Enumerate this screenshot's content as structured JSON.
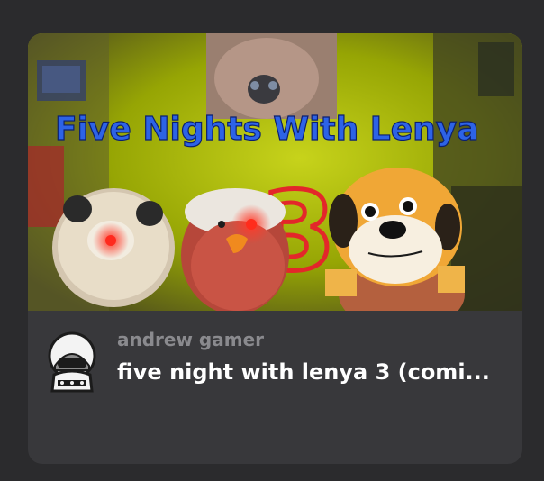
{
  "video": {
    "thumbnail_title": "Five Nights With Lenya",
    "thumbnail_number": "3",
    "channel_name": "andrew gamer",
    "title": "five night with lenya 3 (comi..."
  },
  "icons": {
    "avatar": "hooded-character-icon"
  },
  "colors": {
    "background": "#2b2b2d",
    "card": "#38383b",
    "title_text": "#ffffff",
    "channel_text": "#8a8a8e",
    "thumbnail_title": "#2d63e6"
  }
}
